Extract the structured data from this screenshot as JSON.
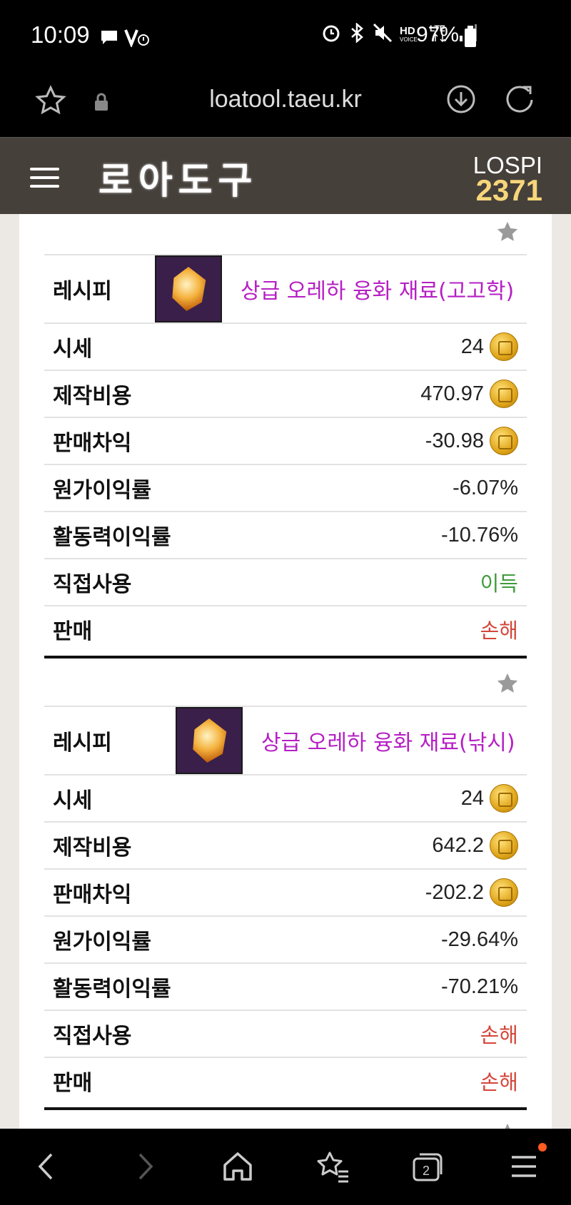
{
  "status_bar": {
    "time": "10:09",
    "battery": "97%",
    "indicators": [
      "chat-icon",
      "wifi-call-icon",
      "alarm-icon",
      "bluetooth-icon",
      "mute-icon",
      "hd-voice-icon",
      "lte-icon",
      "signal-icon",
      "battery-icon"
    ]
  },
  "browser": {
    "url": "loatool.taeu.kr"
  },
  "header": {
    "logo": "로아도구",
    "lospi_label": "LOSPI",
    "lospi_value": "2371"
  },
  "recipes": [
    {
      "label": "레시피",
      "item_name": "상급 오레하 융화 재료(고고학)",
      "rows": [
        {
          "label": "시세",
          "value": "24",
          "coin": true
        },
        {
          "label": "제작비용",
          "value": "470.97",
          "coin": true
        },
        {
          "label": "판매차익",
          "value": "-30.98",
          "coin": true
        },
        {
          "label": "원가이익률",
          "value": "-6.07%"
        },
        {
          "label": "활동력이익률",
          "value": "-10.76%"
        },
        {
          "label": "직접사용",
          "value": "이득",
          "status": "green"
        },
        {
          "label": "판매",
          "value": "손해",
          "status": "red"
        }
      ]
    },
    {
      "label": "레시피",
      "item_name": "상급 오레하 융화 재료(낚시)",
      "rows": [
        {
          "label": "시세",
          "value": "24",
          "coin": true
        },
        {
          "label": "제작비용",
          "value": "642.2",
          "coin": true
        },
        {
          "label": "판매차익",
          "value": "-202.2",
          "coin": true
        },
        {
          "label": "원가이익률",
          "value": "-29.64%"
        },
        {
          "label": "활동력이익률",
          "value": "-70.21%"
        },
        {
          "label": "직접사용",
          "value": "손해",
          "status": "red"
        },
        {
          "label": "판매",
          "value": "손해",
          "status": "red"
        }
      ]
    }
  ],
  "colors": {
    "header_bg": "#46403b",
    "lospi_value": "#f7d67a",
    "item_name": "#b61fc4",
    "profit": "#3f9b3c",
    "loss": "#d4463a"
  },
  "bottom_nav": {
    "tab_count": "2",
    "icons": [
      "back-icon",
      "forward-icon",
      "home-icon",
      "bookmarks-icon",
      "tabs-icon",
      "menu-icon"
    ]
  }
}
